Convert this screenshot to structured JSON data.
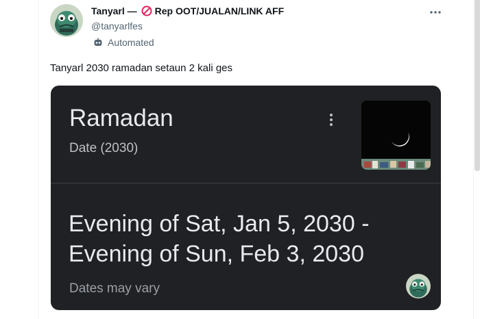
{
  "tweet": {
    "author": {
      "display_name": "Tanyarl —",
      "name_suffix": "Rep OOT/JUALAN/LINK AFF",
      "name_emoji": "no-entry-icon",
      "handle": "@tanyarlfes",
      "automated_label": "Automated"
    },
    "text": "Tanyarl 2030 ramadan setaun 2 kali ges",
    "more_icon": "more-horizontal-icon"
  },
  "card": {
    "title": "Ramadan",
    "subtitle": "Date (2030)",
    "dates_line1": "Evening of Sat, Jan 5, 2030 -",
    "dates_line2": "Evening of Sun, Feb 3, 2030",
    "note": "Dates may vary",
    "menu_icon": "more-vertical-icon",
    "thumbnail": "crescent-moon-image"
  },
  "colors": {
    "card_bg": "#202124",
    "card_text": "#e8eaed",
    "secondary_text": "#536471",
    "no_entry_red": "#e0245e"
  }
}
